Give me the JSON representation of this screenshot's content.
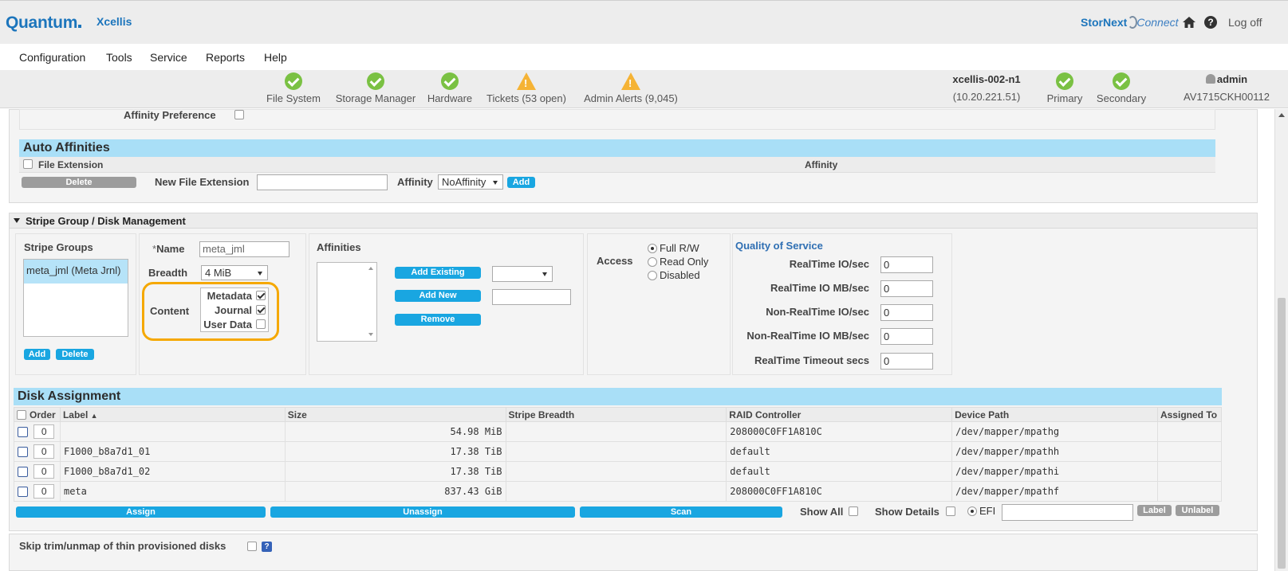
{
  "header": {
    "brand": "Quantum",
    "product": "Xcellis",
    "stornext": "StorNext",
    "connect": "Connect",
    "logoff": "Log off"
  },
  "menu": [
    "Configuration",
    "Tools",
    "Service",
    "Reports",
    "Help"
  ],
  "status": {
    "file_system": "File System",
    "storage_manager": "Storage Manager",
    "hardware": "Hardware",
    "tickets": "Tickets (53 open)",
    "admin_alerts": "Admin Alerts (9,045)",
    "hostname": "xcellis-002-n1",
    "ip": "(10.20.221.51)",
    "primary": "Primary",
    "secondary": "Secondary",
    "user": "admin",
    "serial": "AV1715CKH00112"
  },
  "affinity": {
    "preference_label": "Affinity Preference",
    "auto_title": "Auto Affinities",
    "col_file_extension": "File Extension",
    "col_affinity": "Affinity",
    "delete": "Delete",
    "new_ext_label": "New File Extension",
    "affinity_label": "Affinity",
    "affinity_value": "NoAffinity",
    "add": "Add"
  },
  "stripe": {
    "section_title": "Stripe Group / Disk Management",
    "groups_label": "Stripe Groups",
    "group_item": "meta_jml (Meta Jrnl)",
    "add": "Add",
    "delete": "Delete",
    "name_label": "Name",
    "name_star": "*",
    "name_value": "meta_jml",
    "breadth_label": "Breadth",
    "breadth_value": "4 MiB",
    "content_label": "Content",
    "metadata": "Metadata",
    "journal": "Journal",
    "user_data": "User Data",
    "affinities_label": "Affinities",
    "add_existing": "Add Existing",
    "add_new": "Add New",
    "remove": "Remove",
    "access_label": "Access",
    "full_rw": "Full R/W",
    "read_only": "Read Only",
    "disabled": "Disabled",
    "qos_title": "Quality of Service",
    "qos_rt_io": "RealTime IO/sec",
    "qos_rt_mb": "RealTime IO MB/sec",
    "qos_nrt_io": "Non-RealTime IO/sec",
    "qos_nrt_mb": "Non-RealTime IO MB/sec",
    "qos_timeout": "RealTime Timeout secs",
    "qos_values": [
      "0",
      "0",
      "0",
      "0",
      "0"
    ]
  },
  "disks": {
    "title": "Disk Assignment",
    "columns": [
      "Order",
      "Label",
      "Size",
      "Stripe Breadth",
      "RAID Controller",
      "Device Path",
      "Assigned To"
    ],
    "sort_indicator": "▲",
    "rows": [
      {
        "order": "0",
        "label": "",
        "size": "54.98 MiB",
        "breadth": "",
        "raid": "208000C0FF1A810C",
        "path": "/dev/mapper/mpathg",
        "assigned": ""
      },
      {
        "order": "0",
        "label": "F1000_b8a7d1_01",
        "size": "17.38 TiB",
        "breadth": "",
        "raid": "default",
        "path": "/dev/mapper/mpathh",
        "assigned": ""
      },
      {
        "order": "0",
        "label": "F1000_b8a7d1_02",
        "size": "17.38 TiB",
        "breadth": "",
        "raid": "default",
        "path": "/dev/mapper/mpathi",
        "assigned": ""
      },
      {
        "order": "0",
        "label": "meta",
        "size": "837.43 GiB",
        "breadth": "",
        "raid": "208000C0FF1A810C",
        "path": "/dev/mapper/mpathf",
        "assigned": ""
      }
    ],
    "assign": "Assign",
    "unassign": "Unassign",
    "scan": "Scan",
    "show_all": "Show All",
    "show_details": "Show Details",
    "efi": "EFI",
    "label_btn": "Label",
    "unlabel_btn": "Unlabel"
  },
  "skip_trim": "Skip trim/unmap of thin provisioned disks"
}
